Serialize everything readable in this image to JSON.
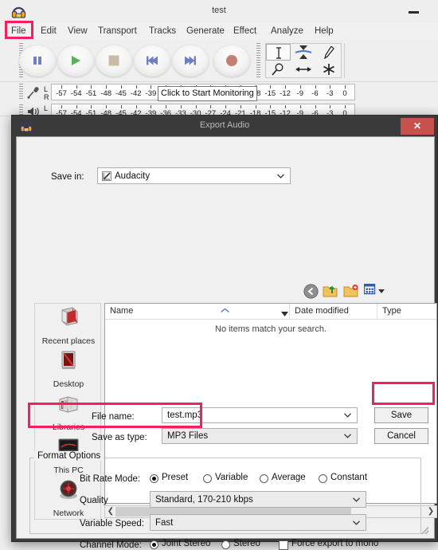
{
  "app": {
    "title": "test",
    "icon": "audacity-headphone-icon",
    "minimize_label": "Minimize",
    "menu": [
      {
        "label": "File",
        "highlighted": true
      },
      {
        "label": "Edit"
      },
      {
        "label": "View"
      },
      {
        "label": "Transport"
      },
      {
        "label": "Tracks"
      },
      {
        "label": "Generate"
      },
      {
        "label": "Effect"
      },
      {
        "label": "Analyze"
      },
      {
        "label": "Help"
      }
    ],
    "transport_buttons": [
      {
        "name": "pause-button",
        "icon": "pause-icon",
        "color": "#6f7fbf"
      },
      {
        "name": "play-button",
        "icon": "play-icon",
        "color": "#57b256"
      },
      {
        "name": "stop-button",
        "icon": "stop-icon",
        "color": "#c9bca6"
      },
      {
        "name": "skip-to-start-button",
        "icon": "skip-start-icon",
        "color": "#6f7fbf"
      },
      {
        "name": "skip-to-end-button",
        "icon": "skip-end-icon",
        "color": "#6f7fbf"
      },
      {
        "name": "record-button",
        "icon": "record-icon",
        "color": "#c47e76"
      }
    ],
    "tools": [
      {
        "name": "selection-tool",
        "icon": "i-beam-icon",
        "selected": true
      },
      {
        "name": "envelope-tool",
        "icon": "envelope-icon",
        "selected": false
      },
      {
        "name": "draw-tool",
        "icon": "pencil-icon",
        "selected": false
      },
      {
        "name": "zoom-tool",
        "icon": "magnifier-icon",
        "selected": false
      },
      {
        "name": "timeshift-tool",
        "icon": "double-arrow-icon",
        "selected": false
      },
      {
        "name": "multi-tool",
        "icon": "asterisk-icon",
        "selected": false
      }
    ],
    "meters": {
      "record_icon": "microphone-icon",
      "play_icon": "speaker-icon",
      "channels": [
        "L",
        "R"
      ],
      "scale": [
        "-57",
        "-54",
        "-51",
        "-48",
        "-45",
        "-42",
        "-39",
        "-36",
        "-33",
        "-30",
        "-27",
        "-24",
        "-21",
        "-18",
        "-15",
        "-12",
        "-9",
        "-6",
        "-3",
        "0"
      ],
      "tooltip": "Click to Start Monitoring"
    }
  },
  "dialog": {
    "title": "Export Audio",
    "icon": "audacity-headphone-icon",
    "close_label": "✕",
    "save_in": {
      "label": "Save in:",
      "value": "Audacity",
      "icon": "audacity-folder-icon"
    },
    "nav_icons": [
      {
        "name": "back-icon",
        "title": "Back"
      },
      {
        "name": "up-one-level-icon",
        "title": "Up One Level"
      },
      {
        "name": "create-new-folder-icon",
        "title": "Create New Folder"
      },
      {
        "name": "views-icon",
        "title": "Views"
      }
    ],
    "places": [
      {
        "label": "Recent places",
        "icon": "recent-places-icon"
      },
      {
        "label": "Desktop",
        "icon": "desktop-icon"
      },
      {
        "label": "Libraries",
        "icon": "libraries-icon"
      },
      {
        "label": "This PC",
        "icon": "this-pc-icon"
      },
      {
        "label": "Network",
        "icon": "network-icon"
      }
    ],
    "file_list": {
      "columns": [
        "Name",
        "Date modified",
        "Type"
      ],
      "empty_message": "No items match your search.",
      "rows": []
    },
    "file_name": {
      "label": "File name:",
      "value": "test.mp3"
    },
    "save_as_type": {
      "label": "Save as type:",
      "value": "MP3 Files",
      "highlighted": true
    },
    "buttons": [
      {
        "label": "Save",
        "name": "save-button",
        "highlighted": true
      },
      {
        "label": "Cancel",
        "name": "cancel-button",
        "highlighted": false
      }
    ],
    "format_options": {
      "caption": "Format Options",
      "bit_rate_mode": {
        "label": "Bit Rate Mode:",
        "options": [
          {
            "label": "Preset",
            "selected": true
          },
          {
            "label": "Variable",
            "selected": false
          },
          {
            "label": "Average",
            "selected": false
          },
          {
            "label": "Constant",
            "selected": false
          }
        ]
      },
      "quality": {
        "label": "Quality",
        "value": "Standard, 170-210 kbps"
      },
      "variable_speed": {
        "label": "Variable Speed:",
        "value": "Fast"
      },
      "channel_mode": {
        "label": "Channel Mode:",
        "options": [
          {
            "label": "Joint Stereo",
            "selected": true
          },
          {
            "label": "Stereo",
            "selected": false
          }
        ],
        "force_mono": {
          "label": "Force export to mono",
          "checked": false
        }
      }
    }
  },
  "colors": {
    "highlight": "#f4205e",
    "dialog_titlebar": "#3a3a3a",
    "close_button": "#c9514d",
    "accent_play": "#57b256",
    "accent_record": "#c47e76"
  }
}
